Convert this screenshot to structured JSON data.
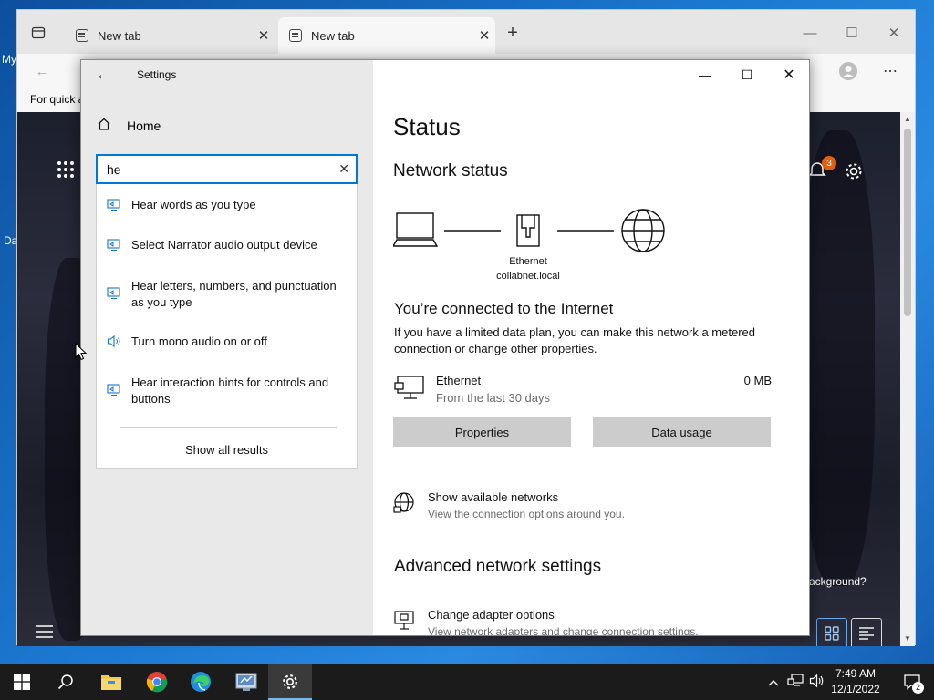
{
  "desktop": {
    "label_top": "My",
    "label_mid": "Da"
  },
  "browser": {
    "tabs": [
      {
        "title": "New tab"
      },
      {
        "title": "New tab"
      }
    ],
    "new_tab_symbol": "+",
    "favorites_bar_text": "For quick a",
    "page": {
      "notification_count": "3",
      "background_prompt": "s background?"
    }
  },
  "settings": {
    "app_title": "Settings",
    "home_label": "Home",
    "search": {
      "value": "he"
    },
    "suggestions": [
      {
        "label": "Hear words as you type",
        "icon": "monitor-icon"
      },
      {
        "label": "Select Narrator audio output device",
        "icon": "monitor-icon"
      },
      {
        "label": "Hear letters, numbers, and punctuation as you type",
        "icon": "monitor-icon"
      },
      {
        "label": "Turn mono audio on or off",
        "icon": "speaker-icon"
      },
      {
        "label": "Hear interaction hints for controls and buttons",
        "icon": "monitor-icon"
      }
    ],
    "show_all_results": "Show all results",
    "content": {
      "page_title": "Status",
      "network_status_heading": "Network status",
      "diagram_label_line1": "Ethernet",
      "diagram_label_line2": "collabnet.local",
      "connected_title": "You’re connected to the Internet",
      "connected_desc": "If you have a limited data plan, you can make this network a metered connection or change other properties.",
      "ethernet": {
        "name": "Ethernet",
        "sub": "From the last 30 days",
        "data_used": "0 MB"
      },
      "properties_button": "Properties",
      "data_usage_button": "Data usage",
      "show_networks_title": "Show available networks",
      "show_networks_desc": "View the connection options around you.",
      "advanced_heading": "Advanced network settings",
      "adapter_title": "Change adapter options",
      "adapter_desc": "View network adapters and change connection settings."
    }
  },
  "taskbar": {
    "time": "7:49 AM",
    "date": "12/1/2022",
    "notification_count": "2"
  },
  "colors": {
    "accent": "#0078d7",
    "taskbar": "#1b1b1b",
    "sidebar": "#e9e9e9",
    "notification_badge": "#e3600f"
  }
}
